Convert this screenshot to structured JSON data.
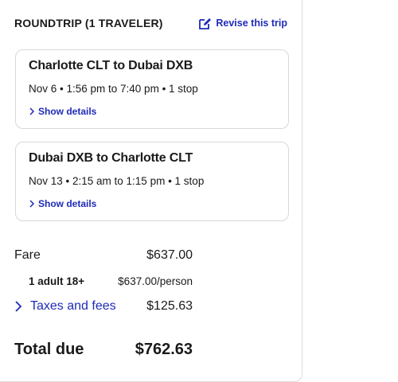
{
  "header": {
    "title": "ROUNDTRIP (1 TRAVELER)",
    "revise_label": "Revise this trip"
  },
  "flights": [
    {
      "route": "Charlotte CLT to Dubai DXB",
      "meta": "Nov 6 • 1:56 pm to 7:40 pm • 1 stop",
      "details_label": "Show details"
    },
    {
      "route": "Dubai DXB to Charlotte CLT",
      "meta": "Nov 13 • 2:15 am to 1:15 pm • 1 stop",
      "details_label": "Show details"
    }
  ],
  "pricing": {
    "fare_label": "Fare",
    "fare_value": "$637.00",
    "adult_label": "1 adult 18+",
    "adult_value": "$637.00/person",
    "taxes_label": "Taxes and fees",
    "taxes_value": "$125.63",
    "total_label": "Total due",
    "total_value": "$762.63"
  },
  "colors": {
    "link": "#1e2bb8",
    "text": "#1a1a1a",
    "border": "#d8d8d8"
  },
  "icons": {
    "revise": "edit-icon",
    "details": "chevron-right-icon",
    "taxes": "chevron-right-icon"
  }
}
